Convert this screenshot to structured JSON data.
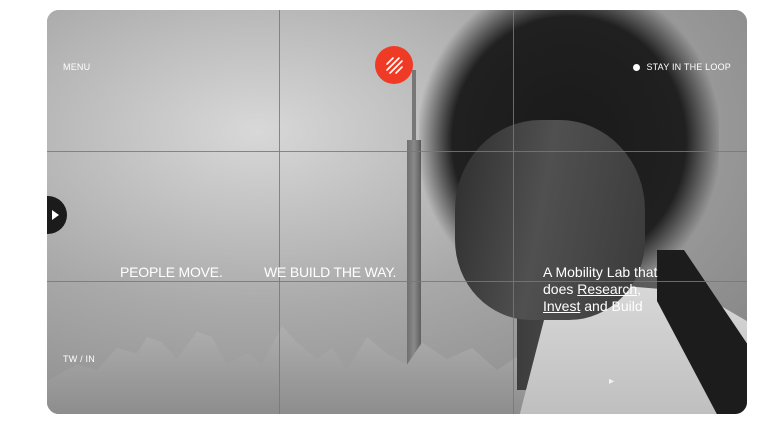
{
  "nav": {
    "menu_label": "MENU",
    "stay_label": "STAY IN THE LOOP"
  },
  "logo": {
    "icon": "slash-lines-logo",
    "color": "#ef3b26"
  },
  "hero": {
    "headline_left": "PEOPLE MOVE.",
    "headline_right": "WE BUILD THE WAY.",
    "tagline_line1": "A Mobility Lab that",
    "tagline_does": "does",
    "tagline_research": "Research,",
    "tagline_invest": "Invest",
    "tagline_and_build": "and Build"
  },
  "footer": {
    "social_label": "TW / IN"
  },
  "controls": {
    "play_icon": "play-icon",
    "next_icon": "arrow-right-icon"
  },
  "colors": {
    "grid": "#ee3e6b",
    "accent": "#ef3b26"
  }
}
